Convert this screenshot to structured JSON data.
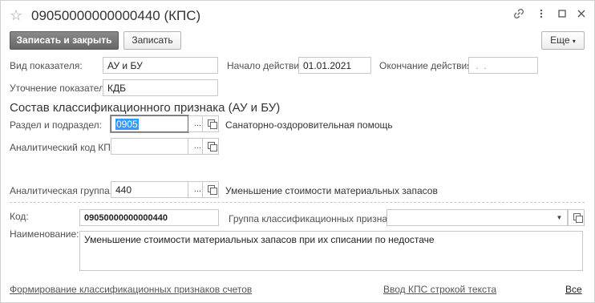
{
  "window": {
    "title": "09050000000000440 (КПС)",
    "icons": [
      "star-icon",
      "link-icon",
      "more-icon",
      "maximize-icon",
      "close-icon"
    ]
  },
  "toolbar": {
    "save_close_label": "Записать и закрыть",
    "save_label": "Записать",
    "more_label": "Еще"
  },
  "fields": {
    "indicator_type_label": "Вид показателя:",
    "indicator_type_value": "АУ и БУ",
    "start_label": "Начало действия:",
    "start_value": "01.01.2021",
    "end_label": "Окончание действия:",
    "end_value": " .  .",
    "clarify_label": "Уточнение показателя:",
    "clarify_value": "КДБ"
  },
  "section": {
    "title": "Состав классификационного признака (АУ и БУ)",
    "razdel_label": "Раздел и подраздел:",
    "razdel_value": "0905",
    "razdel_desc": "Санаторно-оздоровительная помощь",
    "analytic_code_label": "Аналитический код КПС:",
    "analytic_code_value": "",
    "analytic_group_label": "Аналитическая группа:",
    "analytic_group_value": "440",
    "analytic_group_desc": "Уменьшение стоимости материальных запасов",
    "ellipsis": "..."
  },
  "details": {
    "code_label": "Код:",
    "code_value": "09050000000000440",
    "group_label": "Группа классификационных признаков:",
    "group_value": "",
    "name_label": "Наименование:",
    "name_value": "Уменьшение стоимости материальных запасов при их списании по недостаче"
  },
  "footer": {
    "link_form": "Формирование классификационных признаков счетов",
    "link_input": "Ввод КПС строкой текста",
    "link_all": "Все"
  },
  "colors": {
    "primary_button": "#777777",
    "selection": "#3399ff"
  }
}
